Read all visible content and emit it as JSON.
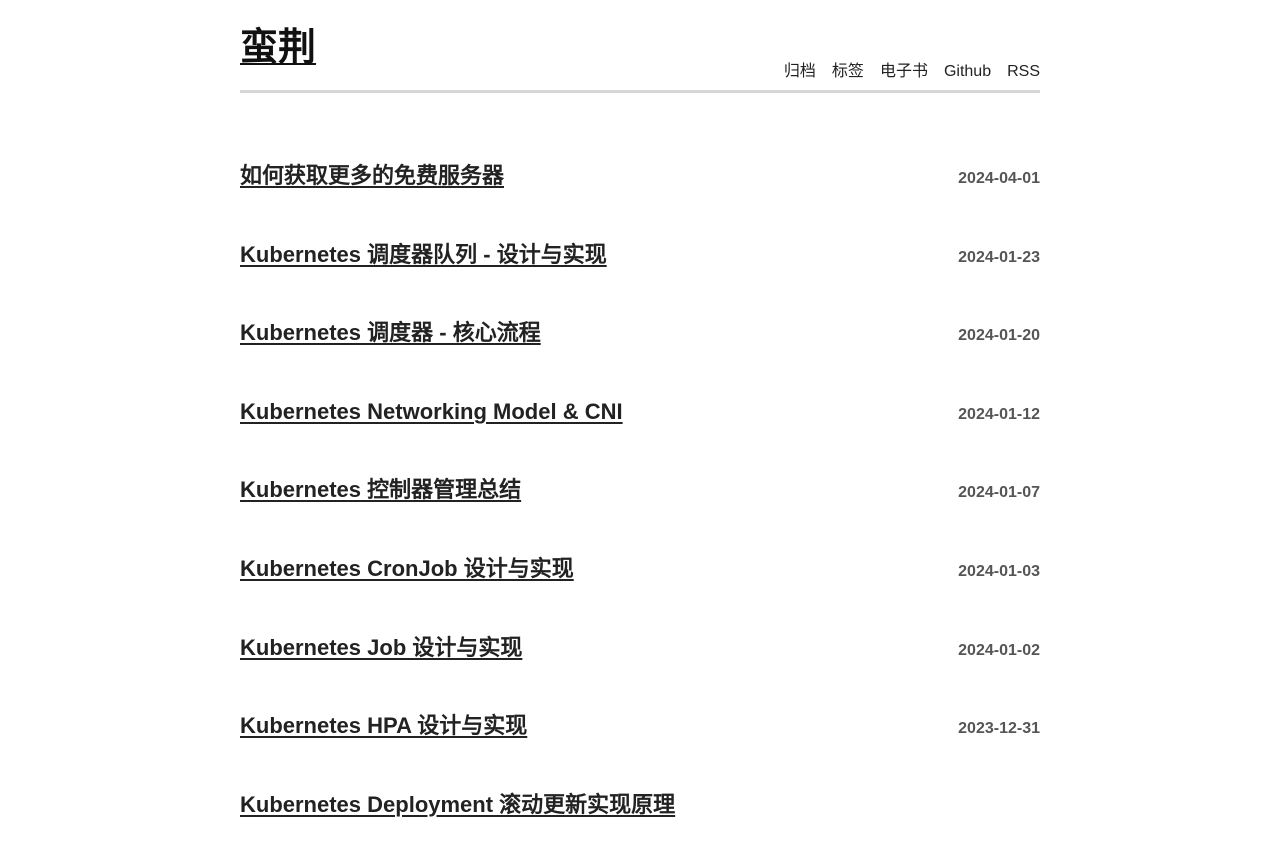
{
  "site": {
    "title": "蛮荆"
  },
  "nav": {
    "items": [
      {
        "label": "归档",
        "name": "nav-archive"
      },
      {
        "label": "标签",
        "name": "nav-tags"
      },
      {
        "label": "电子书",
        "name": "nav-ebook"
      },
      {
        "label": "Github",
        "name": "nav-github"
      },
      {
        "label": "RSS",
        "name": "nav-rss"
      }
    ]
  },
  "posts": [
    {
      "title": "如何获取更多的免费服务器",
      "date": "2024-04-01"
    },
    {
      "title": "Kubernetes 调度器队列 - 设计与实现",
      "date": "2024-01-23"
    },
    {
      "title": "Kubernetes 调度器 - 核心流程",
      "date": "2024-01-20"
    },
    {
      "title": "Kubernetes Networking Model & CNI",
      "date": "2024-01-12"
    },
    {
      "title": "Kubernetes 控制器管理总结",
      "date": "2024-01-07"
    },
    {
      "title": "Kubernetes CronJob 设计与实现",
      "date": "2024-01-03"
    },
    {
      "title": "Kubernetes Job 设计与实现",
      "date": "2024-01-02"
    },
    {
      "title": "Kubernetes HPA 设计与实现",
      "date": "2023-12-31"
    },
    {
      "title": "Kubernetes Deployment 滚动更新实现原理",
      "date": ""
    }
  ]
}
